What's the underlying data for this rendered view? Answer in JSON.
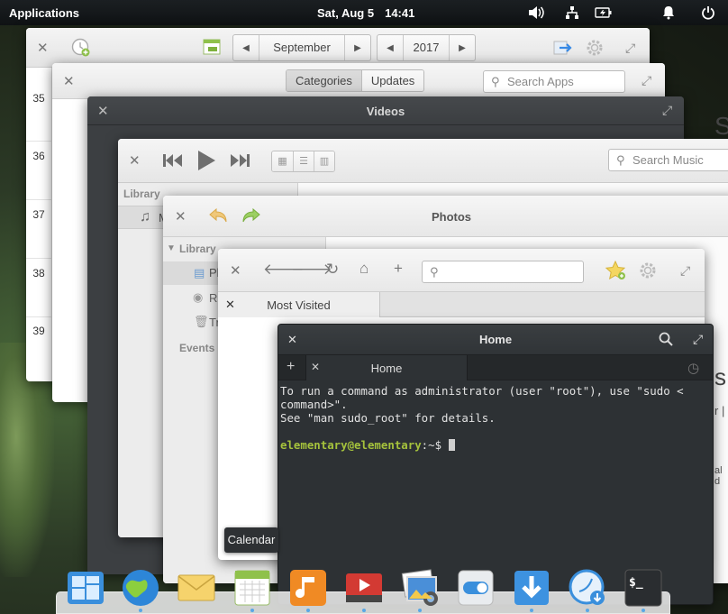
{
  "panel": {
    "applications_label": "Applications",
    "date": "Sat, Aug  5",
    "time": "14:41",
    "icons": [
      "volume-icon",
      "network-icon",
      "battery-icon",
      "notifications-icon",
      "power-icon"
    ]
  },
  "calendar": {
    "month": "September",
    "year": "2017",
    "week_numbers": [
      "35",
      "36",
      "37",
      "38",
      "39"
    ],
    "tooltip": "Calendar"
  },
  "appcenter": {
    "tabs": [
      "Categories",
      "Updates"
    ],
    "search_placeholder": "Search Apps"
  },
  "videos": {
    "title": "Videos"
  },
  "music": {
    "search_placeholder": "Search Music",
    "sidebar_heading": "Library",
    "sidebar_item_fragment": "M",
    "title_fragment": "S"
  },
  "photos": {
    "title": "Photos",
    "sidebar_heading": "Library",
    "sidebar_items": [
      "Pl",
      "Ra",
      "Tr"
    ],
    "events_heading": "Events"
  },
  "web": {
    "tab_label": "Most Visited",
    "url_value": ""
  },
  "terminal": {
    "title": "Home",
    "tab_label": "Home",
    "line1": "To run a command as administrator (user \"root\"), use \"sudo <",
    "line2": "command>\".",
    "line3": "See \"man sudo_root\" for details.",
    "prompt_user": "elementary@elementary",
    "prompt_rest": ":~$ "
  },
  "right_fragments": {
    "r1": "s",
    "r2": "r |",
    "r3": "al d"
  },
  "dock": {
    "apps": [
      "multitasking-view",
      "web-browser",
      "mail",
      "calendar",
      "music",
      "videos",
      "photos",
      "system-settings",
      "appcenter",
      "epiphany-download",
      "terminal"
    ]
  },
  "colors": {
    "accent": "#3689e6",
    "terminal_user": "#a5c23c"
  }
}
